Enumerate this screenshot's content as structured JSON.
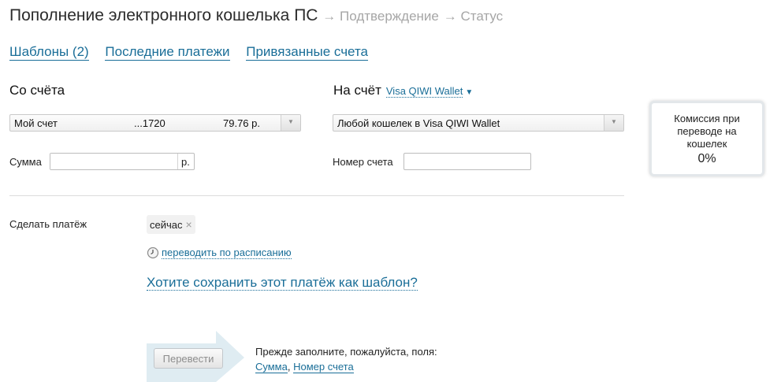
{
  "header": {
    "title": "Пополнение электронного кошелька ПС",
    "step_confirm": "→ Подтверждение",
    "step_status": "→ Статус"
  },
  "tabs": [
    {
      "label": "Шаблоны (2)"
    },
    {
      "label": "Последние платежи"
    },
    {
      "label": "Привязанные счета"
    }
  ],
  "from": {
    "heading": "Со счёта",
    "account_name": "Мой счет",
    "account_number": "...1720",
    "balance": "79.76 р.",
    "amount_label": "Сумма",
    "amount_value": "",
    "currency": "р."
  },
  "to": {
    "heading": "На счёт",
    "wallet_type": "Visa QIWI Wallet",
    "selected": "Любой кошелек в Visa QIWI Wallet",
    "account_label": "Номер счета",
    "account_value": ""
  },
  "commission": {
    "line1": "Комиссия при",
    "line2": "переводе на",
    "line3": "кошелек",
    "value": "0%"
  },
  "schedule": {
    "label": "Сделать платёж",
    "chip": "сейчас",
    "chip_remove": "×",
    "schedule_link": "переводить по расписанию",
    "save_template": "Хотите сохранить этот платёж как шаблон?"
  },
  "submit": {
    "button": "Перевести",
    "hint": "Прежде заполните, пожалуйста, поля:",
    "field1": "Сумма",
    "separator": ",",
    "field2": "Номер счета"
  },
  "colors": {
    "link": "#1a6e98",
    "arrow_bg": "#dfecf2",
    "muted": "#a6a6a6"
  }
}
